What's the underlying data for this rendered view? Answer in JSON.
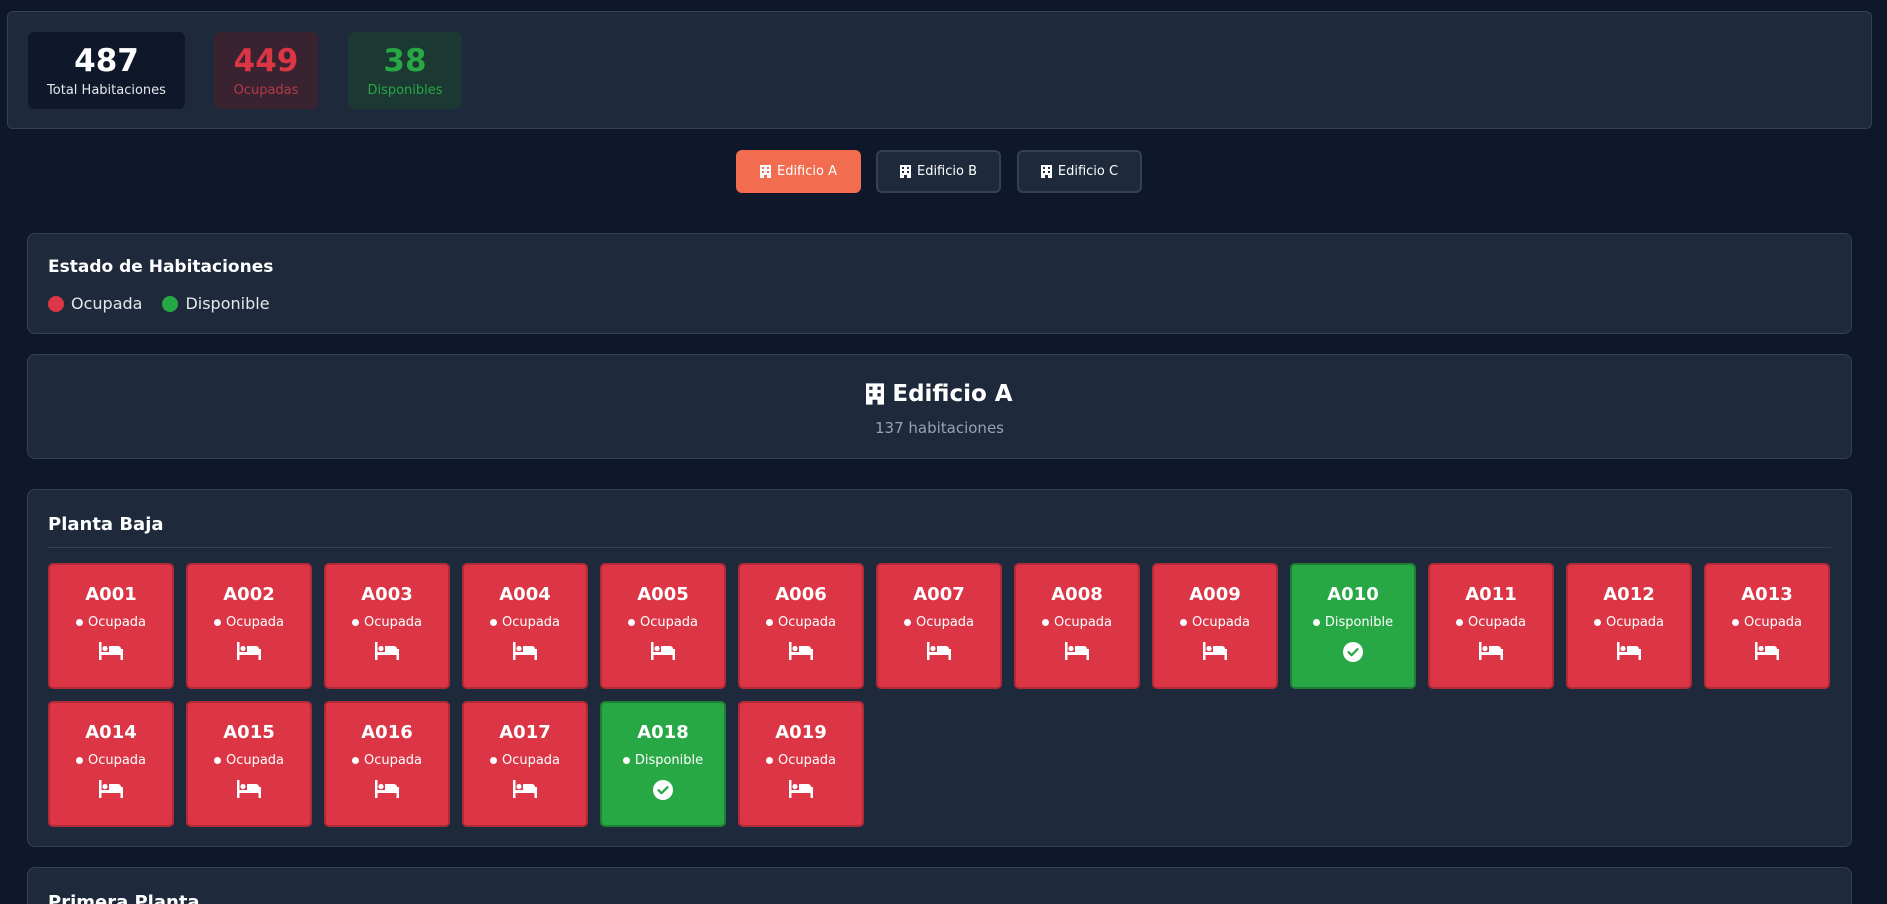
{
  "stats": {
    "total": {
      "value": "487",
      "label": "Total Habitaciones"
    },
    "occupied": {
      "value": "449",
      "label": "Ocupadas"
    },
    "available": {
      "value": "38",
      "label": "Disponibles"
    }
  },
  "tabs": [
    {
      "label": "Edificio A",
      "active": true
    },
    {
      "label": "Edificio B",
      "active": false
    },
    {
      "label": "Edificio C",
      "active": false
    }
  ],
  "legend": {
    "title": "Estado de Habitaciones",
    "items": [
      {
        "label": "Ocupada",
        "color": "#dc3545"
      },
      {
        "label": "Disponible",
        "color": "#28a745"
      }
    ]
  },
  "building": {
    "title": "Edificio A",
    "subtitle": "137 habitaciones"
  },
  "floors": [
    {
      "title": "Planta Baja",
      "rooms": [
        {
          "code": "A001",
          "status": "Ocupada",
          "icon": "bed-icon"
        },
        {
          "code": "A002",
          "status": "Ocupada",
          "icon": "bed-icon"
        },
        {
          "code": "A003",
          "status": "Ocupada",
          "icon": "bed-icon"
        },
        {
          "code": "A004",
          "status": "Ocupada",
          "icon": "bed-icon"
        },
        {
          "code": "A005",
          "status": "Ocupada",
          "icon": "bed-icon"
        },
        {
          "code": "A006",
          "status": "Ocupada",
          "icon": "bed-icon"
        },
        {
          "code": "A007",
          "status": "Ocupada",
          "icon": "bed-icon"
        },
        {
          "code": "A008",
          "status": "Ocupada",
          "icon": "bed-icon"
        },
        {
          "code": "A009",
          "status": "Ocupada",
          "icon": "bed-icon"
        },
        {
          "code": "A010",
          "status": "Disponible",
          "icon": "check-circle-icon"
        },
        {
          "code": "A011",
          "status": "Ocupada",
          "icon": "bed-icon"
        },
        {
          "code": "A012",
          "status": "Ocupada",
          "icon": "bed-icon"
        },
        {
          "code": "A013",
          "status": "Ocupada",
          "icon": "bed-icon"
        },
        {
          "code": "A014",
          "status": "Ocupada",
          "icon": "bed-icon"
        },
        {
          "code": "A015",
          "status": "Ocupada",
          "icon": "bed-icon"
        },
        {
          "code": "A016",
          "status": "Ocupada",
          "icon": "bed-icon"
        },
        {
          "code": "A017",
          "status": "Ocupada",
          "icon": "bed-icon"
        },
        {
          "code": "A018",
          "status": "Disponible",
          "icon": "check-circle-icon"
        },
        {
          "code": "A019",
          "status": "Ocupada",
          "icon": "bed-icon"
        }
      ]
    },
    {
      "title": "Primera Planta",
      "rooms": []
    }
  ]
}
